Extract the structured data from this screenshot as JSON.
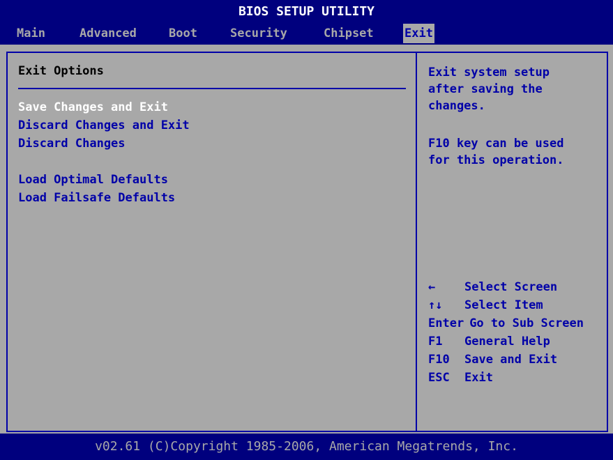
{
  "title": "BIOS SETUP UTILITY",
  "menu": {
    "tabs": [
      {
        "label": "Main"
      },
      {
        "label": "Advanced"
      },
      {
        "label": "Boot"
      },
      {
        "label": "Security"
      },
      {
        "label": "Chipset"
      },
      {
        "label": "Exit",
        "active": true
      }
    ]
  },
  "main": {
    "section_title": "Exit Options",
    "options": [
      {
        "label": "Save Changes and Exit",
        "selected": true
      },
      {
        "label": "Discard Changes and Exit"
      },
      {
        "label": "Discard Changes"
      },
      {
        "label": "Load Optimal Defaults"
      },
      {
        "label": "Load Failsafe Defaults"
      }
    ]
  },
  "help": {
    "description": "Exit system setup\nafter saving the\nchanges.",
    "note": "F10 key can be used\nfor this operation.",
    "keys": [
      {
        "key": "←",
        "action": "Select Screen",
        "icon": "arrow-left-icon"
      },
      {
        "key": "↑↓",
        "action": "Select Item",
        "icon": "arrow-up-down-icon"
      },
      {
        "key": "Enter",
        "action": "Go to Sub Screen"
      },
      {
        "key": "F1",
        "action": "General Help"
      },
      {
        "key": "F10",
        "action": "Save and Exit"
      },
      {
        "key": "ESC",
        "action": "Exit"
      }
    ]
  },
  "footer": "v02.61 (C)Copyright 1985-2006, American Megatrends, Inc.",
  "colors": {
    "background_blue": "#00007e",
    "panel_gray": "#a8a8a8",
    "text_blue": "#0000a8",
    "selected_text": "#ffffff"
  }
}
